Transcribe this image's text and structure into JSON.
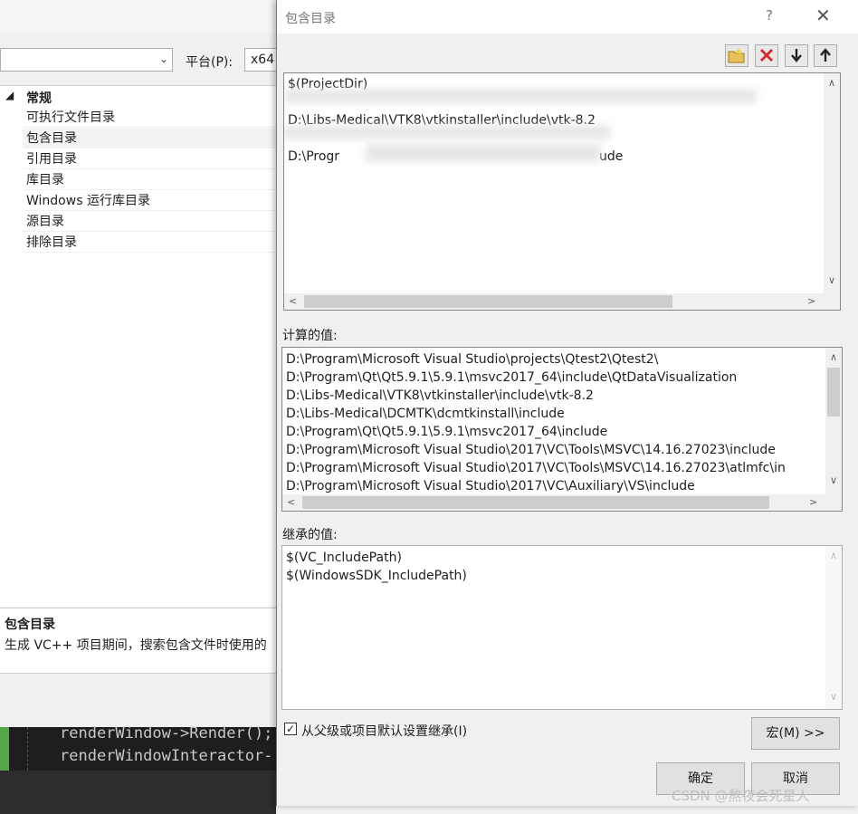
{
  "background": {
    "platform_label": "平台(P):",
    "platform_value": "x64",
    "tree": {
      "group_label": "常规",
      "items": [
        {
          "label": "可执行文件目录"
        },
        {
          "label": "包含目录"
        },
        {
          "label": "引用目录"
        },
        {
          "label": "库目录"
        },
        {
          "label": "Windows 运行库目录"
        },
        {
          "label": "源目录"
        },
        {
          "label": "排除目录"
        }
      ]
    },
    "description": {
      "title": "包含目录",
      "text": "生成 VC++ 项目期间，搜索包含文件时使用的"
    },
    "code_lines": [
      "renderWindow->Render();",
      "renderWindowInteractor-"
    ]
  },
  "dialog": {
    "title": "包含目录",
    "help_glyph": "?",
    "close_glyph": "✕",
    "toolbar": {
      "new_line_icon": "folder-new-icon",
      "delete_icon": "delete-icon",
      "move_down_icon": "arrow-down-icon",
      "move_up_icon": "arrow-up-icon"
    },
    "edit_list": {
      "lines": [
        "$(ProjectDir)",
        "",
        "D:\\Libs-Medical\\VTK8\\vtkinstaller\\include\\vtk-8.2",
        "",
        "D:\\Progr"
      ],
      "partial_tail": "ude"
    },
    "evaluated_label": "计算的值:",
    "evaluated_lines": [
      "D:\\Program\\Microsoft Visual Studio\\projects\\Qtest2\\Qtest2\\",
      "D:\\Program\\Qt\\Qt5.9.1\\5.9.1\\msvc2017_64\\include\\QtDataVisualization",
      "D:\\Libs-Medical\\VTK8\\vtkinstaller\\include\\vtk-8.2",
      "D:\\Libs-Medical\\DCMTK\\dcmtkinstall\\include",
      "D:\\Program\\Qt\\Qt5.9.1\\5.9.1\\msvc2017_64\\include",
      "D:\\Program\\Microsoft Visual Studio\\2017\\VC\\Tools\\MSVC\\14.16.27023\\include",
      "D:\\Program\\Microsoft Visual Studio\\2017\\VC\\Tools\\MSVC\\14.16.27023\\atlmfc\\in",
      "D:\\Program\\Microsoft Visual Studio\\2017\\VC\\Auxiliary\\VS\\include"
    ],
    "inherited_label": "继承的值:",
    "inherited_lines": [
      "$(VC_IncludePath)",
      "$(WindowsSDK_IncludePath)"
    ],
    "inherit_checkbox_label": "从父级或项目默认设置继承(I)",
    "inherit_checked": true,
    "macro_button": "宏(M) >>",
    "ok_button": "确定",
    "cancel_button": "取消"
  },
  "watermark": "CSDN @熬夜会死星人"
}
